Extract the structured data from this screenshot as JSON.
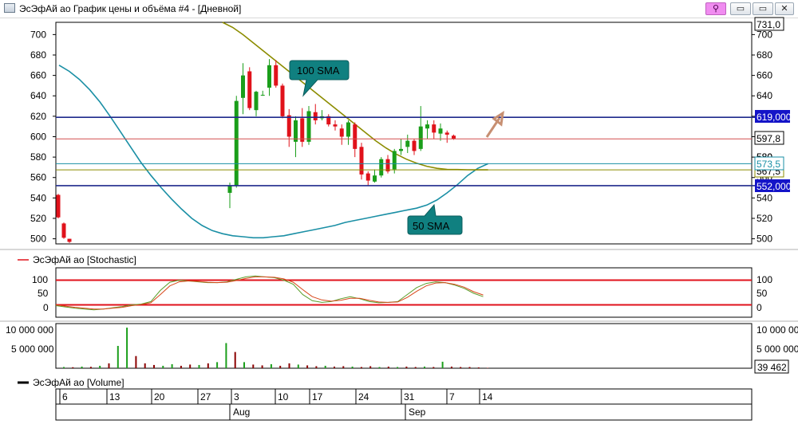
{
  "window": {
    "title": "ЭсЭфАй ао График цены и объёма #4 - [Дневной]",
    "buttons": {
      "minimize": "▭",
      "maximize": "▭",
      "close": "✕",
      "link": "⚲"
    }
  },
  "colors": {
    "up": "#1a9e1a",
    "down": "#e0121b",
    "sma50": "#1a8fa5",
    "sma100": "#8c8c00",
    "level": "#1f2a8c",
    "price_line": "#d44f4f",
    "stoch_band": "#e0121b",
    "arrow": "#c78f72",
    "callout": "#108080"
  },
  "main_panel": {
    "yticks": [
      "700",
      "680",
      "660",
      "640",
      "620",
      "600",
      "580",
      "560",
      "540",
      "520",
      "500"
    ],
    "badges": {
      "top": "731,0",
      "level_high": "619,000",
      "last": "597,8",
      "sma50": "573,5",
      "sma100": "567,5",
      "level_low": "552,000",
      "hidden": "580"
    },
    "callouts": {
      "sma100": "100 SMA",
      "sma50": "50 SMA"
    }
  },
  "stoch_panel": {
    "legend": "ЭсЭфАй ао [Stochastic]",
    "yticks": [
      "100",
      "50",
      "0"
    ]
  },
  "volume_panel": {
    "legend": "ЭсЭфАй ао [Volume]",
    "yticks_left": [
      "10 000 000",
      "5 000 000"
    ],
    "yticks_right": [
      "10 000 000",
      "5 000 000"
    ],
    "last_badge": "39 462"
  },
  "time_axis": {
    "days": [
      "6",
      "13",
      "20",
      "27",
      "3",
      "10",
      "17",
      "24",
      "31",
      "7",
      "14"
    ],
    "months": [
      "Aug",
      "Sep"
    ]
  },
  "chart_data": {
    "type": "candlestick",
    "ylim": [
      495,
      712
    ],
    "levels": [
      619,
      552
    ],
    "last_price": 597.8,
    "candles": [
      {
        "o": 543,
        "h": 544,
        "l": 520,
        "c": 521
      },
      {
        "o": 515,
        "h": 516,
        "l": 500,
        "c": 501
      },
      {
        "o": 500,
        "h": 500,
        "l": 496,
        "c": 497
      },
      {
        "o": 545,
        "h": 555,
        "l": 530,
        "c": 552
      },
      {
        "o": 552,
        "h": 640,
        "l": 550,
        "c": 635
      },
      {
        "o": 638,
        "h": 672,
        "l": 622,
        "c": 660
      },
      {
        "o": 664,
        "h": 668,
        "l": 626,
        "c": 628
      },
      {
        "o": 626,
        "h": 645,
        "l": 620,
        "c": 644
      },
      {
        "o": 641,
        "h": 645,
        "l": 640,
        "c": 641
      },
      {
        "o": 648,
        "h": 676,
        "l": 640,
        "c": 670
      },
      {
        "o": 670,
        "h": 675,
        "l": 648,
        "c": 650
      },
      {
        "o": 650,
        "h": 652,
        "l": 618,
        "c": 620
      },
      {
        "o": 621,
        "h": 627,
        "l": 590,
        "c": 600
      },
      {
        "o": 595,
        "h": 620,
        "l": 580,
        "c": 616
      },
      {
        "o": 618,
        "h": 628,
        "l": 590,
        "c": 595
      },
      {
        "o": 595,
        "h": 630,
        "l": 592,
        "c": 625
      },
      {
        "o": 624,
        "h": 632,
        "l": 612,
        "c": 616
      },
      {
        "o": 618,
        "h": 626,
        "l": 616,
        "c": 620
      },
      {
        "o": 620,
        "h": 622,
        "l": 610,
        "c": 612
      },
      {
        "o": 612,
        "h": 616,
        "l": 606,
        "c": 610
      },
      {
        "o": 608,
        "h": 612,
        "l": 592,
        "c": 600
      },
      {
        "o": 600,
        "h": 616,
        "l": 592,
        "c": 614
      },
      {
        "o": 612,
        "h": 614,
        "l": 580,
        "c": 588
      },
      {
        "o": 590,
        "h": 594,
        "l": 558,
        "c": 563
      },
      {
        "o": 564,
        "h": 566,
        "l": 552,
        "c": 557
      },
      {
        "o": 556,
        "h": 568,
        "l": 555,
        "c": 562
      },
      {
        "o": 562,
        "h": 580,
        "l": 560,
        "c": 578
      },
      {
        "o": 578,
        "h": 582,
        "l": 564,
        "c": 566
      },
      {
        "o": 568,
        "h": 588,
        "l": 564,
        "c": 586
      },
      {
        "o": 586,
        "h": 598,
        "l": 582,
        "c": 588
      },
      {
        "o": 590,
        "h": 602,
        "l": 584,
        "c": 596
      },
      {
        "o": 596,
        "h": 598,
        "l": 582,
        "c": 586
      },
      {
        "o": 588,
        "h": 630,
        "l": 586,
        "c": 610
      },
      {
        "o": 608,
        "h": 616,
        "l": 598,
        "c": 612
      },
      {
        "o": 612,
        "h": 616,
        "l": 598,
        "c": 604
      },
      {
        "o": 603,
        "h": 613,
        "l": 596,
        "c": 608
      },
      {
        "o": 604,
        "h": 606,
        "l": 594,
        "c": 602
      },
      {
        "o": 601,
        "h": 602,
        "l": 597,
        "c": 598
      }
    ],
    "sma50": [
      [
        0,
        670
      ],
      [
        1,
        664
      ],
      [
        2,
        656
      ],
      [
        3,
        646
      ],
      [
        4,
        634
      ],
      [
        5,
        620
      ],
      [
        6,
        605
      ],
      [
        7,
        590
      ],
      [
        8,
        575
      ],
      [
        9,
        562
      ],
      [
        10,
        550
      ],
      [
        11,
        539
      ],
      [
        12,
        529
      ],
      [
        13,
        520
      ],
      [
        14,
        513
      ],
      [
        15,
        508
      ],
      [
        16,
        505
      ],
      [
        17,
        503
      ],
      [
        18,
        502
      ],
      [
        19,
        501
      ],
      [
        20,
        501
      ],
      [
        21,
        502
      ],
      [
        22,
        503
      ],
      [
        23,
        505
      ],
      [
        24,
        507
      ],
      [
        25,
        509
      ],
      [
        26,
        511
      ],
      [
        27,
        513
      ],
      [
        28,
        516
      ],
      [
        29,
        518
      ],
      [
        30,
        520
      ],
      [
        31,
        522
      ],
      [
        32,
        524
      ],
      [
        33,
        526
      ],
      [
        34,
        528
      ],
      [
        35,
        530
      ],
      [
        36,
        533
      ],
      [
        37,
        538
      ],
      [
        38,
        545
      ],
      [
        39,
        553
      ],
      [
        40,
        562
      ],
      [
        41,
        569
      ],
      [
        42,
        573.5
      ]
    ],
    "sma100": [
      [
        16,
        712
      ],
      [
        17,
        707
      ],
      [
        18,
        700
      ],
      [
        19,
        692
      ],
      [
        20,
        684
      ],
      [
        21,
        676
      ],
      [
        22,
        668
      ],
      [
        23,
        660
      ],
      [
        24,
        652
      ],
      [
        25,
        644
      ],
      [
        26,
        636
      ],
      [
        27,
        628
      ],
      [
        28,
        620
      ],
      [
        29,
        612
      ],
      [
        30,
        604
      ],
      [
        31,
        596
      ],
      [
        32,
        589
      ],
      [
        33,
        583
      ],
      [
        34,
        578
      ],
      [
        35,
        574
      ],
      [
        36,
        571
      ],
      [
        37,
        569
      ],
      [
        38,
        568
      ],
      [
        39,
        567.8
      ],
      [
        40,
        567.6
      ],
      [
        41,
        567.5
      ],
      [
        42,
        567.5
      ]
    ],
    "stochastic": {
      "ylim": [
        -10,
        110
      ],
      "bands": [
        80,
        20
      ],
      "k": [
        18,
        15,
        12,
        10,
        8,
        10,
        13,
        16,
        20,
        22,
        28,
        55,
        75,
        80,
        78,
        76,
        74,
        74,
        76,
        82,
        88,
        90,
        88,
        86,
        80,
        70,
        45,
        30,
        26,
        28,
        35,
        40,
        35,
        28,
        25,
        26,
        28,
        45,
        62,
        72,
        76,
        74,
        68,
        60,
        48,
        40
      ],
      "d": [
        20,
        17,
        14,
        12,
        10,
        10,
        12,
        14,
        18,
        21,
        25,
        45,
        66,
        76,
        78,
        77,
        75,
        74,
        75,
        79,
        84,
        88,
        88,
        87,
        83,
        75,
        57,
        40,
        32,
        29,
        31,
        36,
        36,
        31,
        27,
        26,
        27,
        38,
        53,
        66,
        73,
        74,
        70,
        63,
        52,
        44
      ]
    },
    "volume": {
      "ylim": [
        0,
        11000000
      ],
      "values": [
        {
          "v": 300000,
          "up": true
        },
        {
          "v": 250000,
          "up": false
        },
        {
          "v": 400000,
          "up": true
        },
        {
          "v": 350000,
          "up": false
        },
        {
          "v": 600000,
          "up": true
        },
        {
          "v": 1200000,
          "up": false
        },
        {
          "v": 5500000,
          "up": true
        },
        {
          "v": 10000000,
          "up": true
        },
        {
          "v": 3000000,
          "up": false
        },
        {
          "v": 1200000,
          "up": false
        },
        {
          "v": 800000,
          "up": false
        },
        {
          "v": 600000,
          "up": true
        },
        {
          "v": 1000000,
          "up": true
        },
        {
          "v": 600000,
          "up": false
        },
        {
          "v": 900000,
          "up": false
        },
        {
          "v": 800000,
          "up": true
        },
        {
          "v": 1200000,
          "up": false
        },
        {
          "v": 1500000,
          "up": true
        },
        {
          "v": 6200000,
          "up": true
        },
        {
          "v": 4000000,
          "up": false
        },
        {
          "v": 1500000,
          "up": true
        },
        {
          "v": 900000,
          "up": false
        },
        {
          "v": 700000,
          "up": false
        },
        {
          "v": 1000000,
          "up": true
        },
        {
          "v": 600000,
          "up": false
        },
        {
          "v": 1200000,
          "up": false
        },
        {
          "v": 900000,
          "up": true
        },
        {
          "v": 700000,
          "up": false
        },
        {
          "v": 500000,
          "up": false
        },
        {
          "v": 600000,
          "up": true
        },
        {
          "v": 400000,
          "up": false
        },
        {
          "v": 500000,
          "up": false
        },
        {
          "v": 400000,
          "up": true
        },
        {
          "v": 300000,
          "up": false
        },
        {
          "v": 500000,
          "up": false
        },
        {
          "v": 300000,
          "up": true
        },
        {
          "v": 400000,
          "up": false
        },
        {
          "v": 300000,
          "up": true
        },
        {
          "v": 400000,
          "up": false
        },
        {
          "v": 300000,
          "up": false
        },
        {
          "v": 400000,
          "up": true
        },
        {
          "v": 300000,
          "up": false
        },
        {
          "v": 1600000,
          "up": true
        },
        {
          "v": 400000,
          "up": false
        },
        {
          "v": 300000,
          "up": false
        },
        {
          "v": 300000,
          "up": false
        },
        {
          "v": 200000,
          "up": false
        },
        {
          "v": 100000,
          "up": false
        }
      ]
    }
  }
}
